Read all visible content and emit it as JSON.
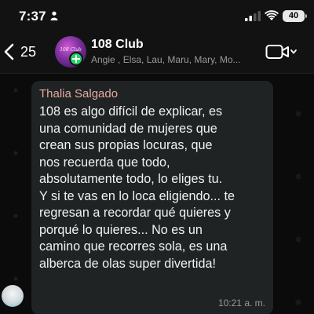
{
  "status_bar": {
    "time": "7:37",
    "battery": "40"
  },
  "header": {
    "back_count": "25",
    "group_name": "108 Club",
    "avatar_text": "108 Club",
    "members": "Angie , Elsa, Lau, Maru, Mary, Mo..."
  },
  "message": {
    "sender": "Thalia Salgado",
    "text": "108 es algo difícil de explicar, es\nuna comunidad de mujeres que\ncrean sus propias locuras, que\nnos recuerda que todo,\nabsolutamente todo, lo eliges tu.\nY si te vas en lo loca eligiendo... te\nregresan a recordar qué quieres y\nporqué lo quieres... No es un\ncamino que recorres sola, es una\nalberca de olas super divertida!",
    "time": "10:21 a. m."
  },
  "colors": {
    "sender_name": "#e7a9a0",
    "bubble": "#1f2324",
    "accent": "#25d366"
  },
  "icons": [
    "person-icon",
    "signal-icon",
    "wifi-icon",
    "battery-icon",
    "chevron-left-icon",
    "add-badge-icon",
    "video-call-icon",
    "chevron-down-icon"
  ]
}
